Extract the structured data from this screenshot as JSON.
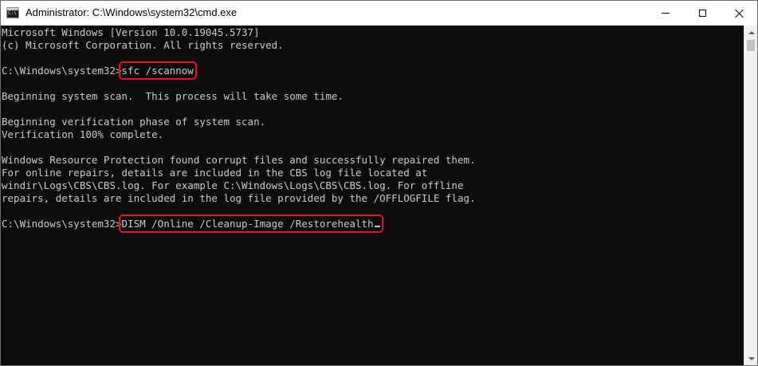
{
  "window": {
    "title": "Administrator: C:\\Windows\\system32\\cmd.exe",
    "icon": "cmd-icon",
    "icon_text": "C:\\"
  },
  "controls": {
    "minimize": "minimize-icon",
    "maximize": "maximize-icon",
    "close": "close-icon"
  },
  "console": {
    "lines": [
      "Microsoft Windows [Version 10.0.19045.5737]",
      "(c) Microsoft Corporation. All rights reserved.",
      "",
      "",
      "",
      "Beginning system scan.  This process will take some time.",
      "",
      "Beginning verification phase of system scan.",
      "Verification 100% complete.",
      "",
      "Windows Resource Protection found corrupt files and successfully repaired them.",
      "For online repairs, details are included in the CBS log file located at",
      "windir\\Logs\\CBS\\CBS.log. For example C:\\Windows\\Logs\\CBS\\CBS.log. For offline",
      "repairs, details are included in the log file provided by the /OFFLOGFILE flag.",
      "",
      ""
    ],
    "prompt": "C:\\Windows\\system32>",
    "command1": "sfc /scannow",
    "command2": "DISM /Online /Cleanup-Image /Restorehealth"
  },
  "colors": {
    "background": "#0c0c0c",
    "text": "#cccccc",
    "highlight": "#e81123"
  }
}
